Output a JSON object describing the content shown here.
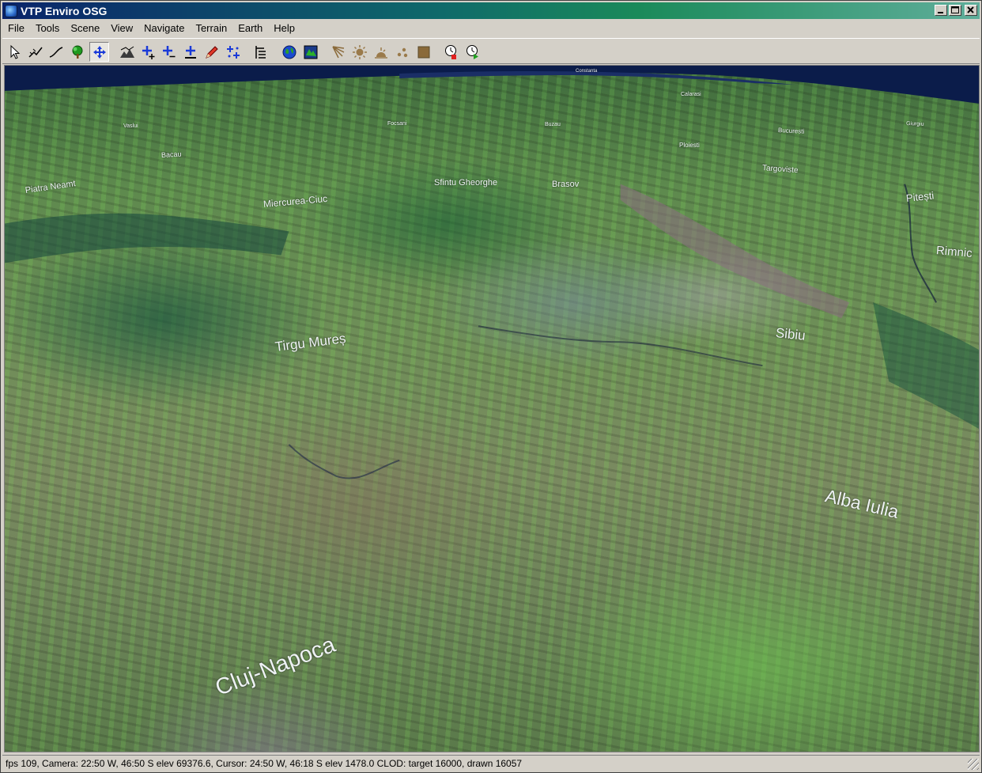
{
  "window": {
    "title": "VTP Enviro OSG"
  },
  "menu": [
    {
      "label": "File"
    },
    {
      "label": "Tools"
    },
    {
      "label": "Scene"
    },
    {
      "label": "View"
    },
    {
      "label": "Navigate"
    },
    {
      "label": "Terrain"
    },
    {
      "label": "Earth"
    },
    {
      "label": "Help"
    }
  ],
  "toolbar": {
    "buttons": [
      {
        "icon": "select-arrow-icon"
      },
      {
        "icon": "measure-path-icon"
      },
      {
        "icon": "draw-line-icon"
      },
      {
        "icon": "tree-icon"
      },
      {
        "icon": "move-icon",
        "pressed": true
      },
      {
        "icon": "terrain-view-icon"
      },
      {
        "icon": "nav-add-icon"
      },
      {
        "icon": "nav-remove-icon"
      },
      {
        "icon": "nav-elevate-icon"
      },
      {
        "icon": "pencil-icon"
      },
      {
        "icon": "nav-multi-icon"
      },
      {
        "icon": "layers-icon"
      },
      {
        "icon": "globe-icon"
      },
      {
        "icon": "earth-map-icon"
      },
      {
        "icon": "light-rays-icon"
      },
      {
        "icon": "sun-icon"
      },
      {
        "icon": "sunset-icon"
      },
      {
        "icon": "dots-icon"
      },
      {
        "icon": "square-icon"
      },
      {
        "icon": "clock-stop-icon"
      },
      {
        "icon": "clock-play-icon"
      }
    ]
  },
  "map_labels": [
    {
      "name": "Constanta"
    },
    {
      "name": "Calarasi"
    },
    {
      "name": "Giurgiu"
    },
    {
      "name": "Vaslui"
    },
    {
      "name": "Focsani"
    },
    {
      "name": "Buzau"
    },
    {
      "name": "Bucuresti"
    },
    {
      "name": "Ploiesti"
    },
    {
      "name": "Bacau"
    },
    {
      "name": "Targoviste"
    },
    {
      "name": "Piatra Neamt"
    },
    {
      "name": "Sfintu Gheorghe"
    },
    {
      "name": "Brasov"
    },
    {
      "name": "Pitești"
    },
    {
      "name": "Miercurea-Ciuc"
    },
    {
      "name": "Rimnic"
    },
    {
      "name": "Sibiu"
    },
    {
      "name": "Tirgu Mureș"
    },
    {
      "name": "Alba Iulia"
    },
    {
      "name": "Cluj-Napoca"
    }
  ],
  "status": {
    "text": "fps 109, Camera:  22:50 W,  46:50 S elev 69376.6, Cursor:  24:50 W,  46:18 S elev 1478.0 CLOD: target 16000, drawn 16057"
  },
  "colors": {
    "title_gradient_start": "#0a246a",
    "title_gradient_end": "#5fae9a",
    "sky": "#0a1a4a",
    "chrome": "#d4d0c8"
  }
}
